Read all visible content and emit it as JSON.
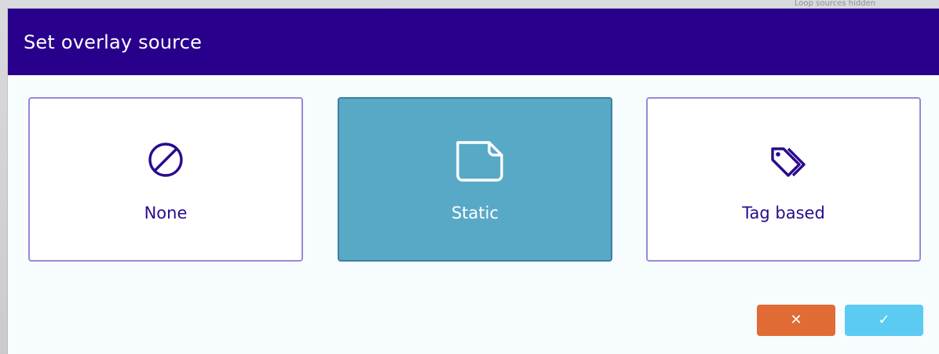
{
  "dialog": {
    "title": "Set overlay source",
    "options": [
      {
        "label": "None",
        "icon": "no-entry-icon",
        "selected": false
      },
      {
        "label": "Static",
        "icon": "file-icon",
        "selected": true
      },
      {
        "label": "Tag based",
        "icon": "tags-icon",
        "selected": false
      }
    ],
    "actions": {
      "cancel_glyph": "✕",
      "confirm_glyph": "✓"
    }
  },
  "colors": {
    "header": "#29008c",
    "dialog_bg": "#f7fdff",
    "option_border": "#9a88d8",
    "option_text": "#2a0a8e",
    "selected_bg": "#58a9c6",
    "cancel": "#e06b35",
    "confirm": "#5ccbf1"
  },
  "backdrop": {
    "hint_text": "Loop sources hidden"
  }
}
